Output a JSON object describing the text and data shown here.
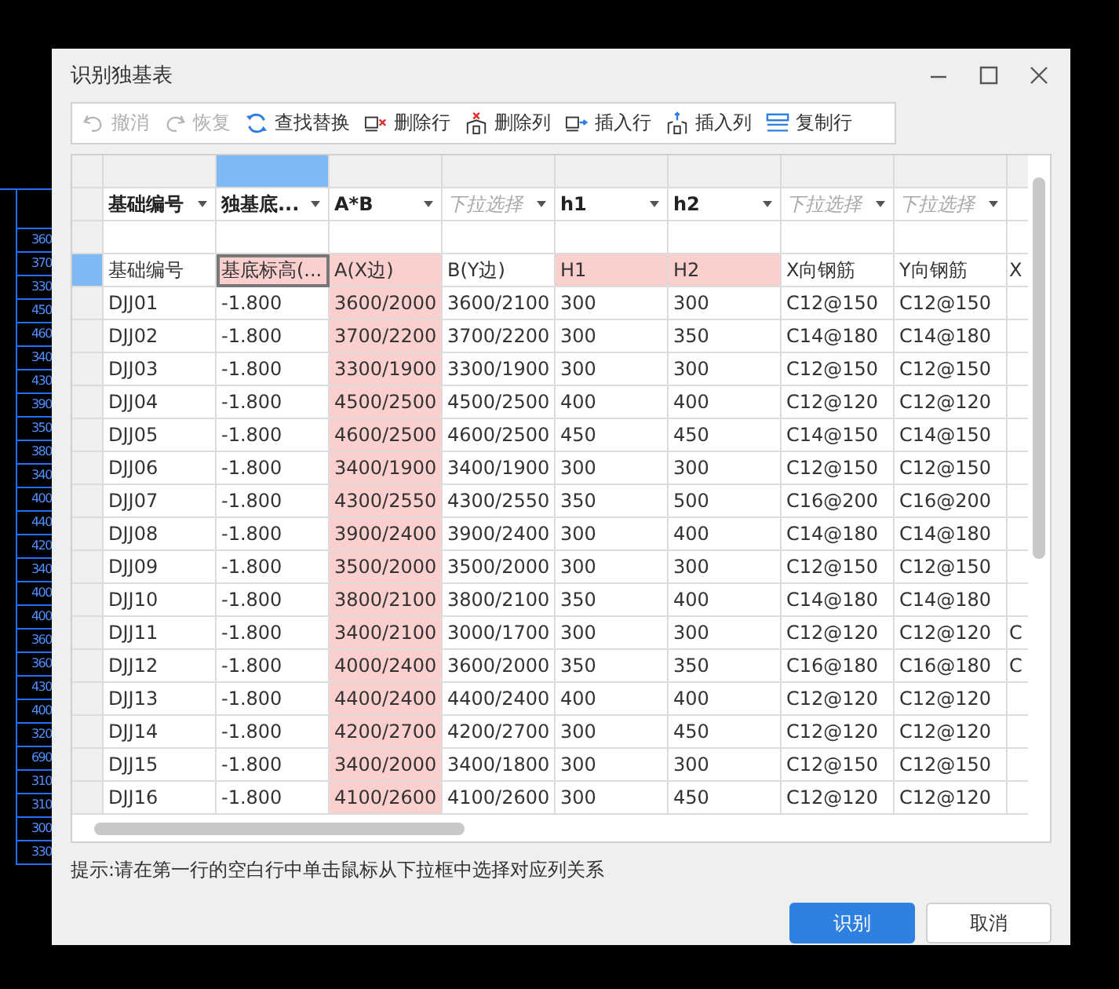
{
  "background": {
    "cad_values": [
      "360",
      "370",
      "330",
      "450",
      "460",
      "340",
      "430",
      "390",
      "350",
      "380",
      "340",
      "400",
      "440",
      "420",
      "340",
      "400",
      "400",
      "360",
      "360",
      "430",
      "400",
      "320",
      "690",
      "310",
      "310",
      "300",
      "330"
    ]
  },
  "window": {
    "title": "识别独基表"
  },
  "toolbar": [
    {
      "label": "撤消",
      "disabled": true
    },
    {
      "label": "恢复",
      "disabled": true
    },
    {
      "label": "查找替换",
      "disabled": false
    },
    {
      "label": "删除行",
      "disabled": false
    },
    {
      "label": "删除列",
      "disabled": false
    },
    {
      "label": "插入行",
      "disabled": false
    },
    {
      "label": "插入列",
      "disabled": false
    },
    {
      "label": "复制行",
      "disabled": false
    }
  ],
  "columns": [
    {
      "mapping": "基础编号",
      "selected": false,
      "highlighted": false
    },
    {
      "mapping": "独基底...",
      "selected": true,
      "highlighted": false
    },
    {
      "mapping": "A*B",
      "selected": false,
      "highlighted": true
    },
    {
      "placeholder": "下拉选择",
      "selected": false,
      "highlighted": false
    },
    {
      "mapping": "h1",
      "selected": false,
      "highlighted": false
    },
    {
      "mapping": "h2",
      "selected": false,
      "highlighted": false
    },
    {
      "placeholder": "下拉选择",
      "selected": false,
      "highlighted": false
    },
    {
      "placeholder": "下拉选择",
      "selected": false,
      "highlighted": false
    }
  ],
  "header_row": {
    "selected": true,
    "extra": "X",
    "cells": [
      {
        "text": "基础编号",
        "highlighted": false,
        "focused": false
      },
      {
        "text": "基底标高(...",
        "highlighted": true,
        "focused": true
      },
      {
        "text": "A(X边)",
        "highlighted": true,
        "focused": false
      },
      {
        "text": "B(Y边)",
        "highlighted": false,
        "focused": false
      },
      {
        "text": "H1",
        "highlighted": true,
        "focused": false
      },
      {
        "text": "H2",
        "highlighted": true,
        "focused": false
      },
      {
        "text": "X向钢筋",
        "highlighted": false,
        "focused": false
      },
      {
        "text": "Y向钢筋",
        "highlighted": false,
        "focused": false
      }
    ]
  },
  "rows": [
    {
      "selected": false,
      "cells": [
        "DJJ01",
        "-1.800",
        "3600/2000",
        "3600/2100",
        "300",
        "300",
        "C12@150",
        "C12@150"
      ]
    },
    {
      "selected": false,
      "cells": [
        "DJJ02",
        "-1.800",
        "3700/2200",
        "3700/2200",
        "300",
        "350",
        "C14@180",
        "C14@180"
      ]
    },
    {
      "selected": false,
      "cells": [
        "DJJ03",
        "-1.800",
        "3300/1900",
        "3300/1900",
        "300",
        "300",
        "C12@150",
        "C12@150"
      ]
    },
    {
      "selected": false,
      "cells": [
        "DJJ04",
        "-1.800",
        "4500/2500",
        "4500/2500",
        "400",
        "400",
        "C12@120",
        "C12@120"
      ]
    },
    {
      "selected": false,
      "cells": [
        "DJJ05",
        "-1.800",
        "4600/2500",
        "4600/2500",
        "450",
        "450",
        "C14@150",
        "C14@150"
      ]
    },
    {
      "selected": false,
      "cells": [
        "DJJ06",
        "-1.800",
        "3400/1900",
        "3400/1900",
        "300",
        "300",
        "C12@150",
        "C12@150"
      ]
    },
    {
      "selected": false,
      "cells": [
        "DJJ07",
        "-1.800",
        "4300/2550",
        "4300/2550",
        "350",
        "500",
        "C16@200",
        "C16@200"
      ]
    },
    {
      "selected": false,
      "cells": [
        "DJJ08",
        "-1.800",
        "3900/2400",
        "3900/2400",
        "300",
        "400",
        "C14@180",
        "C14@180"
      ]
    },
    {
      "selected": false,
      "cells": [
        "DJJ09",
        "-1.800",
        "3500/2000",
        "3500/2000",
        "300",
        "300",
        "C12@150",
        "C12@150"
      ]
    },
    {
      "selected": false,
      "cells": [
        "DJJ10",
        "-1.800",
        "3800/2100",
        "3800/2100",
        "350",
        "400",
        "C14@180",
        "C14@180"
      ]
    },
    {
      "selected": false,
      "extra": "C",
      "cells": [
        "DJJ11",
        "-1.800",
        "3400/2100",
        "3000/1700",
        "300",
        "300",
        "C12@120",
        "C12@120"
      ]
    },
    {
      "selected": false,
      "extra": "C",
      "cells": [
        "DJJ12",
        "-1.800",
        "4000/2400",
        "3600/2000",
        "350",
        "350",
        "C16@180",
        "C16@180"
      ]
    },
    {
      "selected": false,
      "cells": [
        "DJJ13",
        "-1.800",
        "4400/2400",
        "4400/2400",
        "400",
        "400",
        "C12@120",
        "C12@120"
      ]
    },
    {
      "selected": false,
      "cells": [
        "DJJ14",
        "-1.800",
        "4200/2700",
        "4200/2700",
        "300",
        "450",
        "C12@120",
        "C12@120"
      ]
    },
    {
      "selected": false,
      "cells": [
        "DJJ15",
        "-1.800",
        "3400/2000",
        "3400/1800",
        "300",
        "300",
        "C12@150",
        "C12@150"
      ]
    },
    {
      "selected": false,
      "cells": [
        "DJJ16",
        "-1.800",
        "4100/2600",
        "4100/2600",
        "300",
        "450",
        "C12@120",
        "C12@120"
      ]
    }
  ],
  "hint": "提示:请在第一行的空白行中单击鼠标从下拉框中选择对应列关系",
  "buttons": [
    {
      "label": "识别",
      "kind": "primary"
    },
    {
      "label": "取消",
      "kind": "secondary"
    }
  ]
}
